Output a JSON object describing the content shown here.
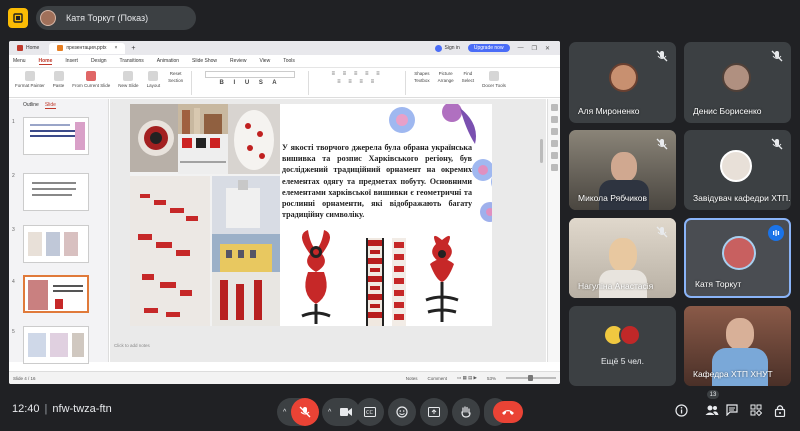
{
  "meeting": {
    "presenter_label": "Катя Торкут (Показ)",
    "time": "12:40",
    "separator": "|",
    "code": "nfw-twza-ftn",
    "participants_badge": "13"
  },
  "colors": {
    "bg": "#202124",
    "tile": "#3c4043",
    "accent_red": "#ea4335",
    "speaking_blue": "#1a73e8",
    "logo_yellow": "#fbbc04",
    "wps_red": "#c0392b"
  },
  "wps": {
    "tabs": [
      "Home",
      "презентация.pptx"
    ],
    "sign_in": "Sign in",
    "upgrade": "Upgrade now",
    "ribbon_menu": [
      "Menu",
      "Home",
      "Insert",
      "Design",
      "Transitions",
      "Animation",
      "Slide Show",
      "Review",
      "View",
      "Tools"
    ],
    "share_label": "Share",
    "tools": [
      "Format Painter",
      "Paste",
      "From Current Slide",
      "New Slide",
      "Layout",
      "Reset",
      "Section",
      "Shapes",
      "Picture",
      "Textbox",
      "Arrange",
      "Find",
      "Select",
      "Docer Tools"
    ],
    "outline_tabs": [
      "Outline",
      "Slide"
    ],
    "thumb_numbers": [
      "1",
      "2",
      "3",
      "4",
      "5"
    ],
    "notes_hint": "Click to add notes",
    "slide_counter": "Slide 4 / 16",
    "notes_btn": "Notes",
    "comment_btn": "Comment",
    "zoom": "53%"
  },
  "slide": {
    "text": "У якості творчого джерела була обрана українська вишивка та розпис Харківського регіону, був досліджений традиційний орнамент на окремих елементах одягу та предметах побуту. Основними елементами харківської вишивки є геометричні та рослинні орнаменти, які відображають багату традиційну символіку."
  },
  "participants": [
    {
      "name": "Аля Мироненко",
      "muted": true
    },
    {
      "name": "Денис Борисенко",
      "muted": true
    },
    {
      "name": "Микола Рябчиков",
      "muted": true
    },
    {
      "name": "Завідувач кафедри ХТП...",
      "muted": true
    },
    {
      "name": "Нагуліна Анастасія",
      "muted": true
    },
    {
      "name": "Катя Торкут",
      "muted": false,
      "speaking": true
    },
    {
      "name": "",
      "muted": false
    },
    {
      "name": "Кафедра ХТП ХНУТ",
      "muted": false
    }
  ],
  "more_label": "Ещё 5 чел.",
  "icons": {
    "logo": "meet-logo-icon",
    "mic": "mic-off-icon",
    "camera": "camera-icon",
    "captions": "captions-icon",
    "emoji": "emoji-icon",
    "present": "present-icon",
    "hand": "raise-hand-icon",
    "more": "more-options-icon",
    "hangup": "hang-up-icon",
    "info": "info-icon",
    "people": "people-icon",
    "chat": "chat-icon",
    "activities": "activities-icon",
    "lock": "host-controls-icon"
  }
}
